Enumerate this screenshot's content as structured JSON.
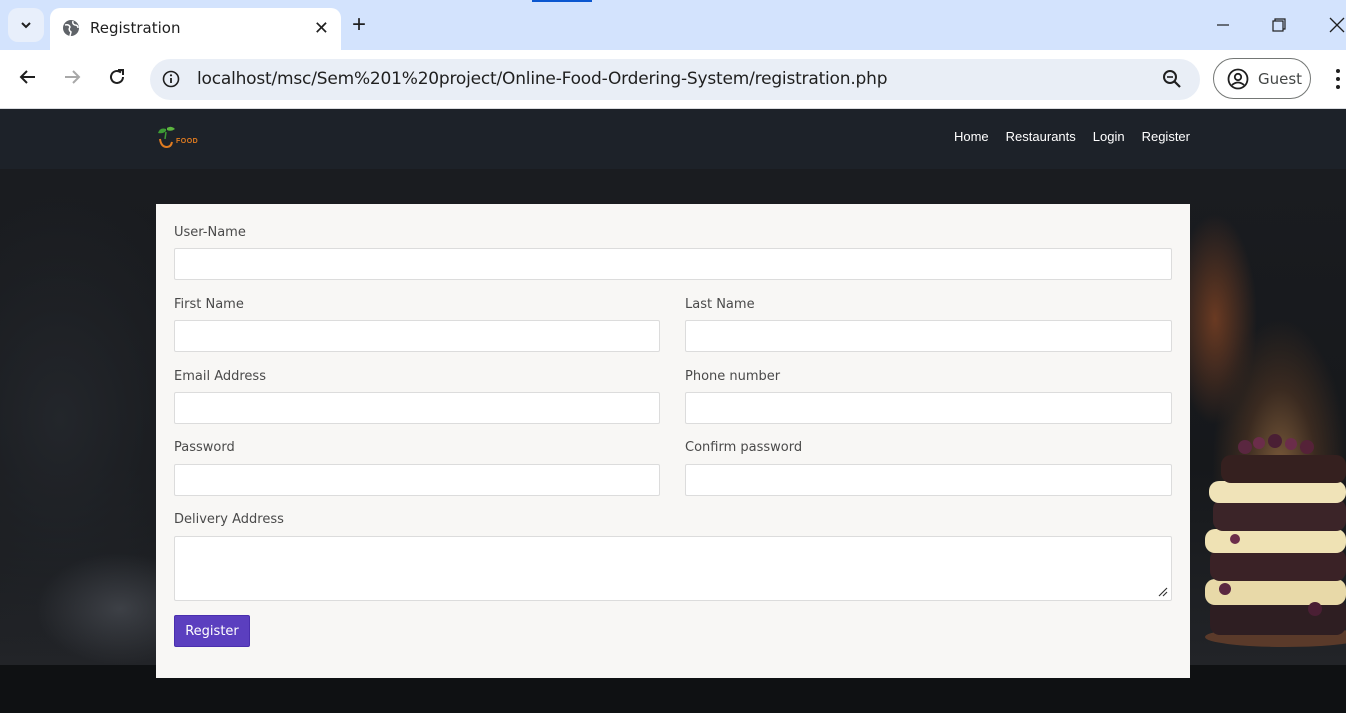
{
  "browser": {
    "tab_title": "Registration",
    "tab_close": "✕",
    "new_tab": "+",
    "url": "localhost/msc/Sem%201%20project/Online-Food-Ordering-System/registration.php",
    "profile_name": "Guest",
    "icons": [
      "tab-search-icon",
      "globe-icon",
      "back-icon",
      "forward-icon",
      "reload-icon",
      "site-info-icon",
      "zoom-icon",
      "avatar-icon",
      "menu-icon",
      "minimize-icon",
      "restore-icon",
      "close-icon"
    ],
    "accent_color": "#0b57d0"
  },
  "site": {
    "logo_text": "FOOD",
    "nav": [
      "Home",
      "Restaurants",
      "Login",
      "Register"
    ]
  },
  "form": {
    "username_label": "User-Name",
    "first_name_label": "First Name",
    "last_name_label": "Last Name",
    "email_label": "Email Address",
    "phone_label": "Phone number",
    "password_label": "Password",
    "confirm_password_label": "Confirm password",
    "address_label": "Delivery Address",
    "submit_label": "Register",
    "button_color": "#5b3fbf"
  }
}
